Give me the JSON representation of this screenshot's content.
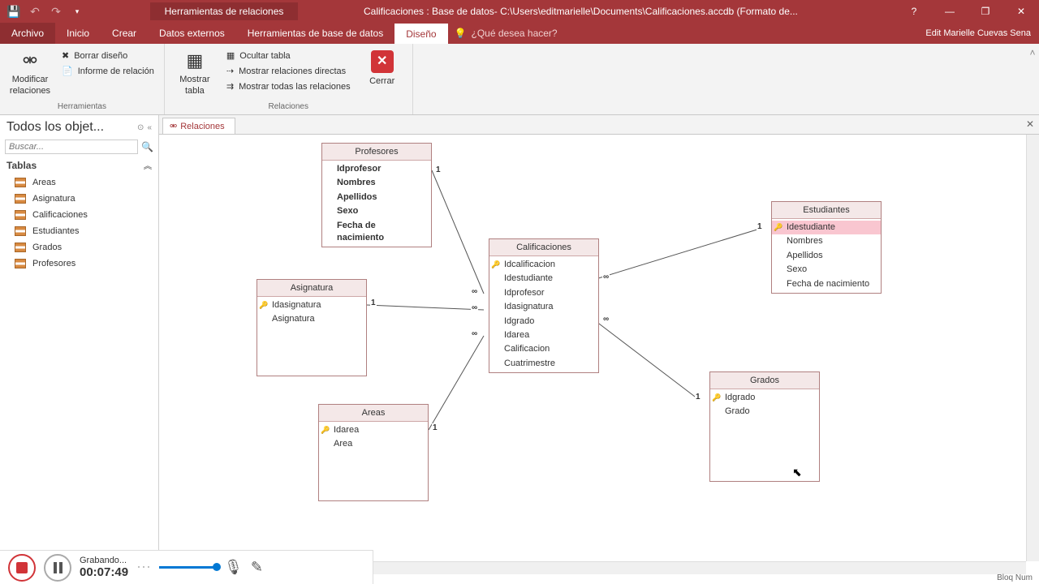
{
  "titlebar": {
    "context_tab": "Herramientas de relaciones",
    "title": "Calificaciones : Base de datos- C:\\Users\\editmarielle\\Documents\\Calificaciones.accdb (Formato de..."
  },
  "tabs": {
    "file": "Archivo",
    "home": "Inicio",
    "create": "Crear",
    "external": "Datos externos",
    "dbtools": "Herramientas de base de datos",
    "design": "Diseño",
    "tellme_placeholder": "¿Qué desea hacer?",
    "user": "Edit Marielle Cuevas Sena"
  },
  "ribbon": {
    "tools_group": "Herramientas",
    "relations_group": "Relaciones",
    "modify": "Modificar relaciones",
    "clear": "Borrar diseño",
    "report": "Informe de relación",
    "show_table": "Mostrar tabla",
    "hide_table": "Ocultar tabla",
    "direct": "Mostrar relaciones directas",
    "all": "Mostrar todas las relaciones",
    "close": "Cerrar"
  },
  "nav": {
    "title": "Todos los objet...",
    "search_placeholder": "Buscar...",
    "tables_header": "Tablas",
    "items": [
      "Areas",
      "Asignatura",
      "Calificaciones",
      "Estudiantes",
      "Grados",
      "Profesores"
    ]
  },
  "doc_tab": "Relaciones",
  "tables": {
    "profesores": {
      "title": "Profesores",
      "fields": [
        "Idprofesor",
        "Nombres",
        "Apellidos",
        "Sexo",
        "Fecha de nacimiento"
      ]
    },
    "asignatura": {
      "title": "Asignatura",
      "fields": [
        "Idasignatura",
        "Asignatura"
      ]
    },
    "areas": {
      "title": "Areas",
      "fields": [
        "Idarea",
        "Area"
      ]
    },
    "calificaciones": {
      "title": "Calificaciones",
      "fields": [
        "Idcalificacion",
        "Idestudiante",
        "Idprofesor",
        "Idasignatura",
        "Idgrado",
        "Idarea",
        "Calificacion",
        "Cuatrimestre"
      ]
    },
    "estudiantes": {
      "title": "Estudiantes",
      "fields": [
        "Idestudiante",
        "Nombres",
        "Apellidos",
        "Sexo",
        "Fecha de nacimiento"
      ]
    },
    "grados": {
      "title": "Grados",
      "fields": [
        "Idgrado",
        "Grado"
      ]
    }
  },
  "recorder": {
    "status": "Grabando...",
    "time": "00:07:49"
  },
  "footer": "Bloq Num"
}
